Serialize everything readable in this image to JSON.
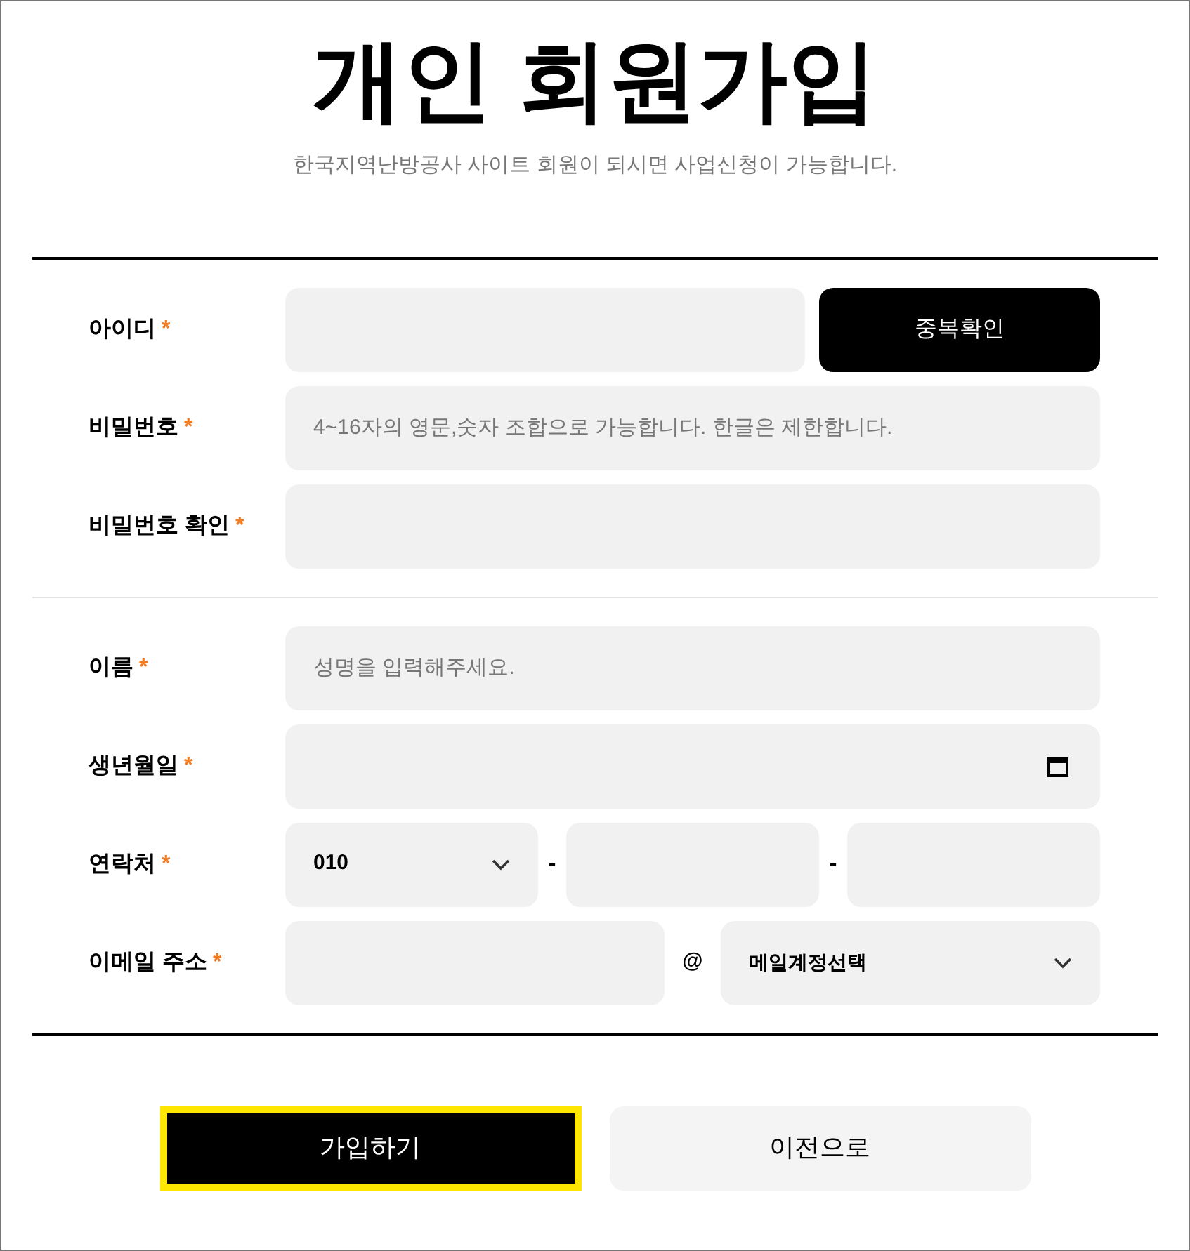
{
  "title": "개인 회원가입",
  "subtitle": "한국지역난방공사 사이트 회원이 되시면 사업신청이 가능합니다.",
  "sections": [
    [
      {
        "kind": "id",
        "label": "아이디",
        "required_mark": "*",
        "button": "중복확인"
      },
      {
        "kind": "text",
        "label": "비밀번호",
        "required_mark": "*",
        "placeholder": "4~16자의 영문,숫자 조합으로 가능합니다. 한글은 제한합니다."
      },
      {
        "kind": "text",
        "label": "비밀번호 확인",
        "required_mark": "*"
      }
    ],
    [
      {
        "kind": "text",
        "label": "이름",
        "required_mark": "*",
        "placeholder": "성명을 입력해주세요."
      },
      {
        "kind": "date",
        "label": "생년월일",
        "required_mark": "*"
      },
      {
        "kind": "phone",
        "label": "연락처",
        "required_mark": "*",
        "prefix": "010",
        "separators": [
          "-",
          "-"
        ]
      },
      {
        "kind": "email",
        "label": "이메일 주소",
        "required_mark": "*",
        "at": "@",
        "domain": "메일계정선택"
      }
    ]
  ],
  "buttons": [
    {
      "label": "가입하기",
      "kind": "primary",
      "focused": true
    },
    {
      "label": "이전으로",
      "kind": "secondary",
      "focused": false
    }
  ]
}
